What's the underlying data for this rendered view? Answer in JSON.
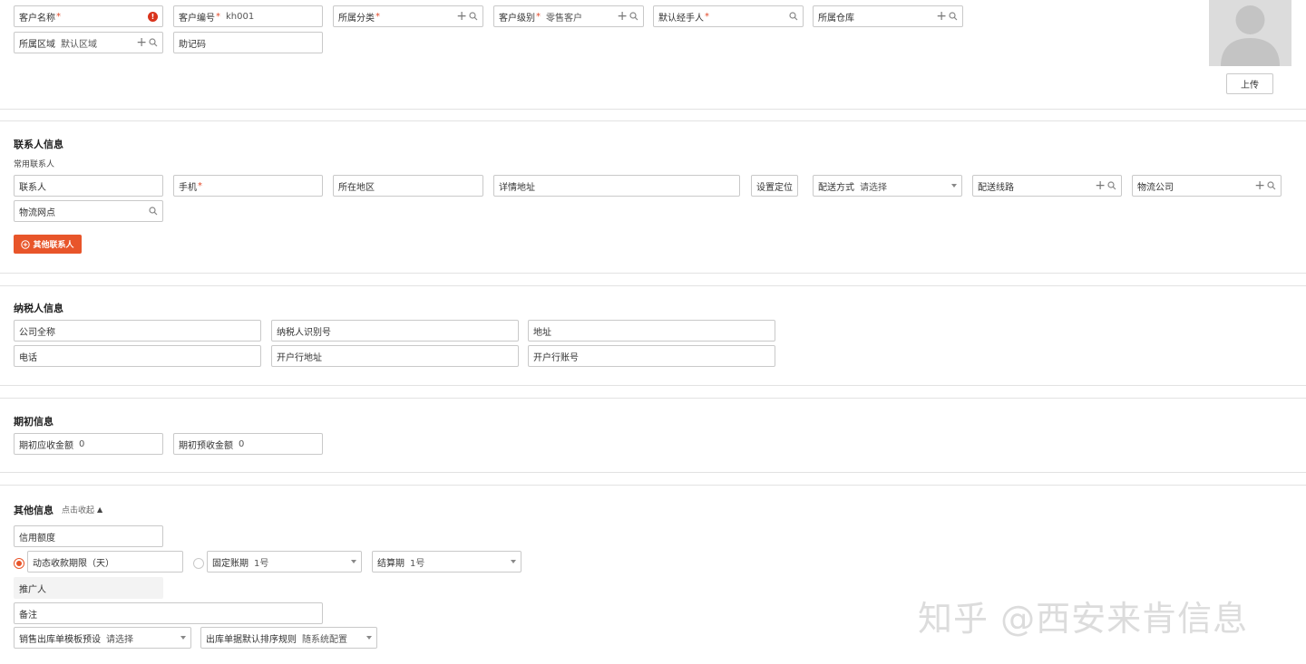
{
  "basic": {
    "customer_name_label": "客户名称",
    "customer_no_label": "客户编号",
    "customer_no_value": "kh001",
    "category_label": "所属分类",
    "level_label": "客户级别",
    "level_value": "零售客户",
    "handler_label": "默认经手人",
    "warehouse_label": "所属仓库",
    "region_label": "所属区域",
    "region_value": "默认区域",
    "mnemonic_label": "助记码",
    "required_mark": "*",
    "error_mark": "!",
    "upload_label": "上传"
  },
  "contact": {
    "title": "联系人信息",
    "subtitle": "常用联系人",
    "person_label": "联系人",
    "phone_label": "手机",
    "area_label": "所在地区",
    "address_label": "详情地址",
    "locate_button": "设置定位",
    "delivery_label": "配送方式",
    "delivery_value": "请选择",
    "route_label": "配送线路",
    "logistics_label": "物流公司",
    "logistics_point_label": "物流网点",
    "add_other_button": "其他联系人"
  },
  "tax": {
    "title": "纳税人信息",
    "company_label": "公司全称",
    "tax_id_label": "纳税人识别号",
    "address_label": "地址",
    "phone_label": "电话",
    "bank_address_label": "开户行地址",
    "bank_account_label": "开户行账号"
  },
  "initial": {
    "title": "期初信息",
    "receivable_label": "期初应收金额",
    "receivable_value": "0",
    "prepaid_label": "期初预收金额",
    "prepaid_value": "0"
  },
  "other": {
    "title": "其他信息",
    "collapse_link": "点击收起",
    "collapse_arrow": "▲",
    "credit_label": "信用额度",
    "dynamic_term_label": "动态收款期限（天）",
    "fixed_term_label": "固定账期",
    "fixed_term_value": "1号",
    "settle_label": "结算期",
    "settle_value": "1号",
    "promoter_label": "推广人",
    "remark_label": "备注",
    "template_label": "销售出库单模板预设",
    "template_value": "请选择",
    "sort_label": "出库单据默认排序规则",
    "sort_value": "随系统配置"
  },
  "watermark": "知乎 @西安来肯信息",
  "colors": {
    "accent": "#e8552a",
    "required": "#e34a2a",
    "error": "#d9341c",
    "divider": "#e2e2e2",
    "field_border": "#c9c9c9"
  }
}
